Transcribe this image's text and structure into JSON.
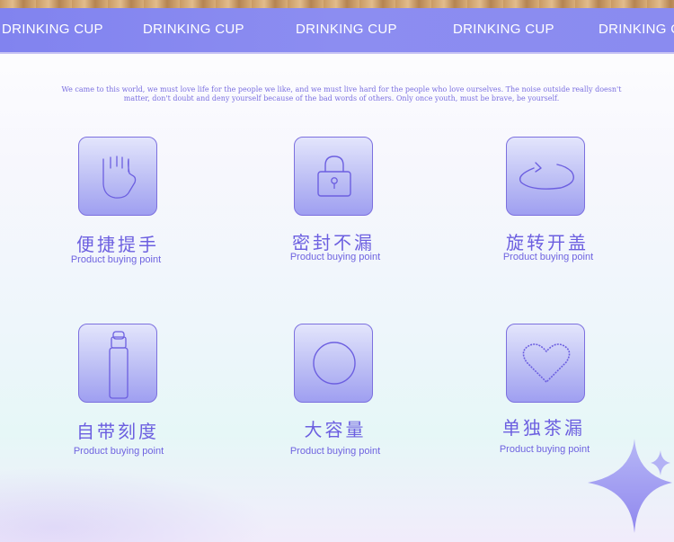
{
  "banner": {
    "labels": [
      "DRINKING CUP",
      "DRINKING CUP",
      "DRINKING CUP",
      "DRINKING CUP",
      "DRINKING C"
    ]
  },
  "slogan": "We came to this world, we must love life for the people we like, and we must live hard for the people who love ourselves. The noise outside really doesn't matter, don't doubt and deny yourself because of the bad words of others. Only once youth, must be brave, be yourself.",
  "features": [
    {
      "title": "便捷提手",
      "subtitle": "Product buying point",
      "icon": "hand-icon"
    },
    {
      "title": "密封不漏",
      "subtitle": "Product buying point",
      "icon": "lock-icon"
    },
    {
      "title": "旋转开盖",
      "subtitle": "Product buying point",
      "icon": "rotate-icon"
    },
    {
      "title": "自带刻度",
      "subtitle": "Product buying point",
      "icon": "bottle-icon"
    },
    {
      "title": "大容量",
      "subtitle": "Product buying point",
      "icon": "circle-icon"
    },
    {
      "title": "单独茶漏",
      "subtitle": "Product buying point",
      "icon": "heart-icon"
    }
  ],
  "colors": {
    "banner": "#8a8bf0",
    "accent": "#6c5fe0",
    "icon_border": "#7c70df"
  }
}
